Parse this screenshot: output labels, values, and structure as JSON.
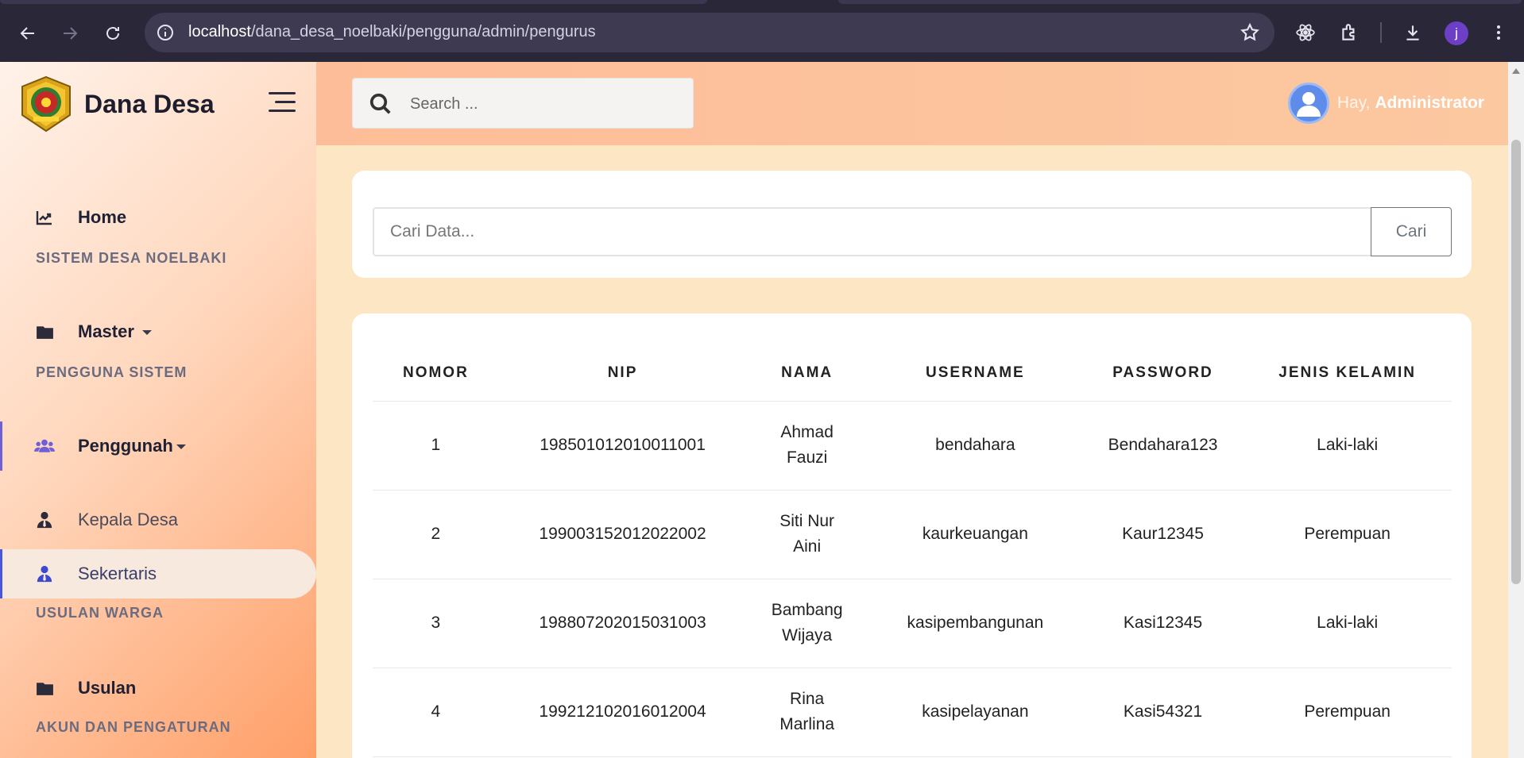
{
  "browser": {
    "url_host": "localhost",
    "url_path": "/dana_desa_noelbaki/pengguna/admin/pengurus",
    "profile_initial": "j"
  },
  "sidebar": {
    "brand": "Dana Desa",
    "home_label": "Home",
    "sections": {
      "sistem": "SISTEM DESA NOELBAKI",
      "pengguna": "PENGGUNA SISTEM",
      "usulan": "USULAN WARGA",
      "akun": "AKUN DAN PENGATURAN"
    },
    "master_label": "Master",
    "penggunah_label": "Penggunah",
    "kepala_desa_label": "Kepala Desa",
    "sekertaris_label": "Sekertaris",
    "usulan_label": "Usulan"
  },
  "header": {
    "search_placeholder": "Search ...",
    "greeting": "Hay,",
    "user_name": "Administrator"
  },
  "filter": {
    "placeholder": "Cari Data...",
    "button_label": "Cari"
  },
  "table": {
    "headers": [
      "NOMOR",
      "NIP",
      "NAMA",
      "USERNAME",
      "PASSWORD",
      "JENIS KELAMIN"
    ],
    "rows": [
      {
        "nomor": "1",
        "nip": "198501012010011001",
        "nama": "Ahmad Fauzi",
        "username": "bendahara",
        "password": "Bendahara123",
        "jk": "Laki-laki"
      },
      {
        "nomor": "2",
        "nip": "199003152012022002",
        "nama": "Siti Nur Aini",
        "username": "kaurkeuangan",
        "password": "Kaur12345",
        "jk": "Perempuan"
      },
      {
        "nomor": "3",
        "nip": "198807202015031003",
        "nama": "Bambang Wijaya",
        "username": "kasipembangunan",
        "password": "Kasi12345",
        "jk": "Laki-laki"
      },
      {
        "nomor": "4",
        "nip": "199212102016012004",
        "nama": "Rina Marlina",
        "username": "kasipelayanan",
        "password": "Kasi54321",
        "jk": "Perempuan"
      }
    ]
  },
  "colors": {
    "sidebar_active": "#4a57d9",
    "group_active": "#6e61d6",
    "avatar": "#5f8cea",
    "topbar": "#fdbd98",
    "content_bg": "#fde6c3"
  }
}
